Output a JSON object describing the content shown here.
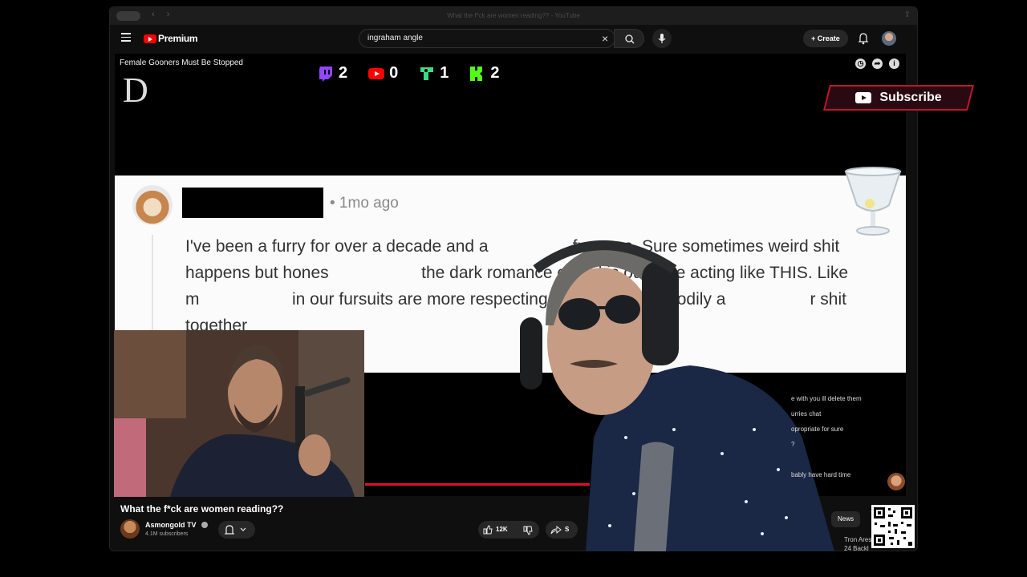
{
  "browser": {
    "tab_title": "What the f*ck are women reading?? - YouTube"
  },
  "masthead": {
    "logo_label": "Premium",
    "search": {
      "value": "ingraham angle",
      "placeholder": "Search"
    },
    "create_label": "Create"
  },
  "video": {
    "overlay_title": "Female Gooners Must Be Stopped",
    "corner_letter": "D",
    "comment": {
      "time": "• 1mo ago",
      "text": "I've been a furry for over a decade and a          fur cons. Sure sometimes weird shit happens but hones           the dark romance crowd is out here acting like THIS. Like m           in our fursuits are more respecting of consent and bodily a          r shit together"
    }
  },
  "stream_overlay": {
    "stats": [
      {
        "icon": "twitch-icon",
        "color": "#9146ff",
        "value": "2"
      },
      {
        "icon": "youtube-icon",
        "color": "#ff0000",
        "value": "0"
      },
      {
        "icon": "kick-alt-icon",
        "color": "#3ddc84",
        "value": "1"
      },
      {
        "icon": "kick-icon",
        "color": "#53fc18",
        "value": "2"
      }
    ],
    "subscribe_label": "Subscribe",
    "chat_lines": [
      "e with you ill delete them",
      "urries chat",
      "opropriate for sure",
      "?",
      "",
      "bably have hard time"
    ],
    "news_chip": "News",
    "side_bottom": [
      "Tron Ares",
      "24 Backl"
    ]
  },
  "below_video": {
    "title": "What the f*ck are women reading??",
    "channel": "Asmongold TV",
    "subscribers": "4.1M subscribers",
    "likes": "12K",
    "share_label": "S"
  },
  "colors": {
    "accent": "#ff0000",
    "subscribe_border": "#c0162e",
    "progress": "#e0102a"
  }
}
